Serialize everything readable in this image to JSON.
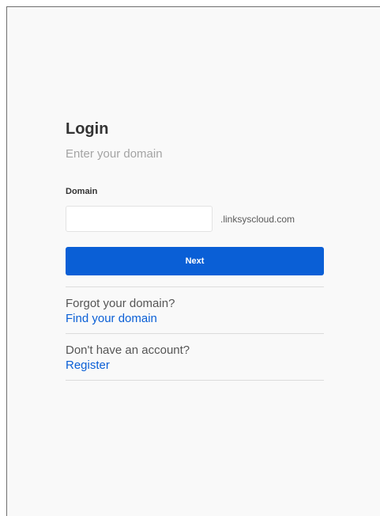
{
  "login": {
    "title": "Login",
    "subtitle": "Enter your domain",
    "domain_label": "Domain",
    "domain_value": "",
    "domain_placeholder": "",
    "domain_suffix": ".linksyscloud.com",
    "next_label": "Next"
  },
  "help": {
    "forgot_text": "Forgot your domain?",
    "forgot_link": "Find your domain",
    "register_text": "Don't have an account?",
    "register_link": "Register"
  },
  "colors": {
    "accent": "#0a5fd6",
    "background": "#f9f9f9"
  }
}
